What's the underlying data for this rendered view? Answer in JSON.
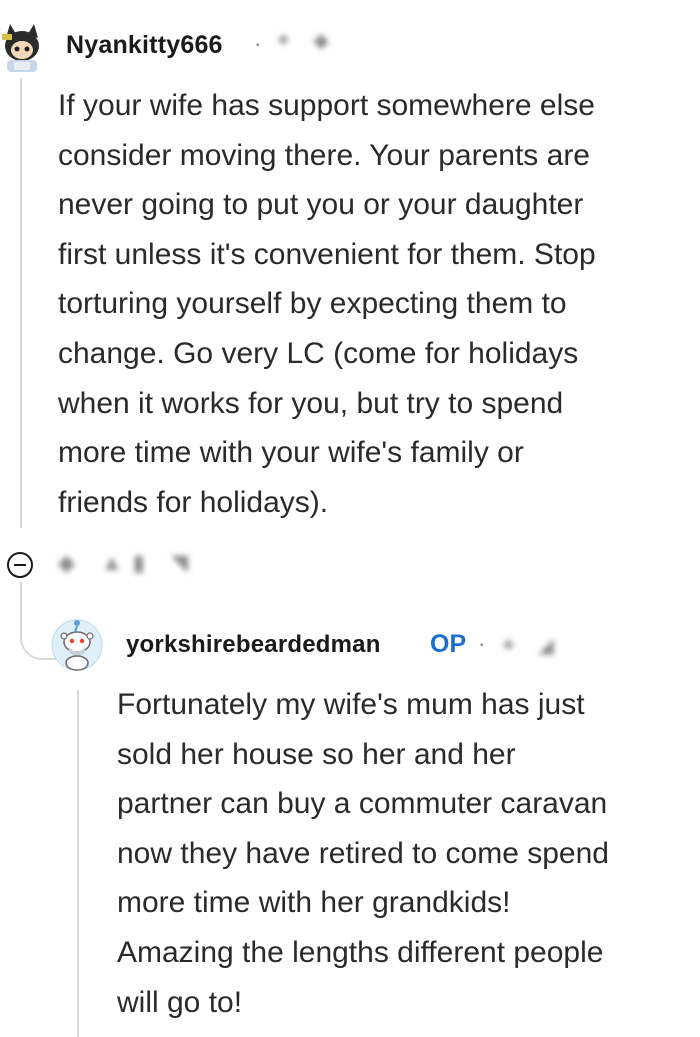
{
  "comments": [
    {
      "username": "Nyankitty666",
      "separator": "·",
      "body": "If your wife has support somewhere else\nconsider moving there. Your parents are\nnever going to put you or your daughter\nfirst unless it's convenient for them. Stop\ntorturing yourself by expecting them to\nchange. Go very LC (come for holidays\nwhen it works for you, but try to spend\nmore time with your wife's family or\nfriends for holidays).",
      "avatar_icon": "cat-avatar-icon"
    },
    {
      "username": "yorkshirebeardedman",
      "badge": "OP",
      "separator": "·",
      "body": "Fortunately my wife's mum has just\nsold her house so her and her\npartner can buy a commuter caravan\nnow they have retired to come spend\nmore time with her grandkids!\nAmazing the lengths different people\nwill go to!",
      "avatar_icon": "snoo-avatar-icon"
    }
  ],
  "colors": {
    "thread_line": "#d9d9d9",
    "op_badge": "#1a6fd1",
    "text": "#2a2a2a"
  }
}
